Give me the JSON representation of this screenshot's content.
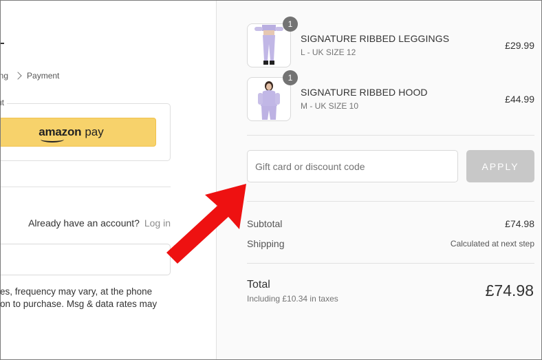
{
  "breadcrumb": {
    "prev_fragment": "ing",
    "current": "Payment"
  },
  "express": {
    "legend_fragment": "ut",
    "amazon_pay_label_a": "amazon",
    "amazon_pay_label_b": "pay"
  },
  "account": {
    "prompt": "Already have an account?",
    "login_link": "Log in"
  },
  "legal": {
    "line1": "es, frequency may vary, at the phone",
    "line2": "on to purchase. Msg & data rates may"
  },
  "cart": {
    "items": [
      {
        "name": "SIGNATURE RIBBED LEGGINGS",
        "variant": "L - UK SIZE 12",
        "price": "£29.99",
        "quantity": "1",
        "image_icon": "leggings-product-image"
      },
      {
        "name": "SIGNATURE RIBBED HOOD",
        "variant": "M - UK SIZE 10",
        "price": "£44.99",
        "quantity": "1",
        "image_icon": "hoodie-product-image"
      }
    ]
  },
  "discount": {
    "placeholder": "Gift card or discount code",
    "apply_label": "APPLY"
  },
  "summary": {
    "subtotal_label": "Subtotal",
    "subtotal_value": "£74.98",
    "shipping_label": "Shipping",
    "shipping_value": "Calculated at next step",
    "total_label": "Total",
    "tax_note": "Including £10.34 in taxes",
    "total_value": "£74.98"
  },
  "colors": {
    "amazon_button": "#f7d26b",
    "apply_button": "#c8c8c8",
    "annotation_arrow": "#ee1111",
    "badge": "#737373"
  }
}
